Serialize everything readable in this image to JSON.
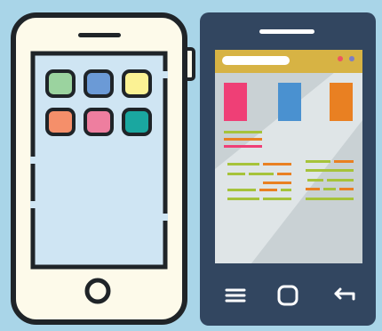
{
  "background": "#a9d5e8",
  "outline": "#1f2428",
  "iphone": {
    "body": "#fdfaea",
    "screen": "#cfe5f3",
    "app_icons": [
      "#9bd39f",
      "#6b9ad6",
      "#fbf294",
      "#f58f6a",
      "#ee7e9f",
      "#1aa7a0"
    ]
  },
  "android": {
    "body": "#324660",
    "screen": "#c9d1d4",
    "top_bar": "#d7b344",
    "dots": [
      "#ee5561",
      "#7d7ec4"
    ],
    "color_blocks": [
      "#ef3f76",
      "#4a91d0",
      "#e98022"
    ],
    "nav_icons": [
      "menu-icon",
      "home-icon",
      "back-icon"
    ]
  }
}
